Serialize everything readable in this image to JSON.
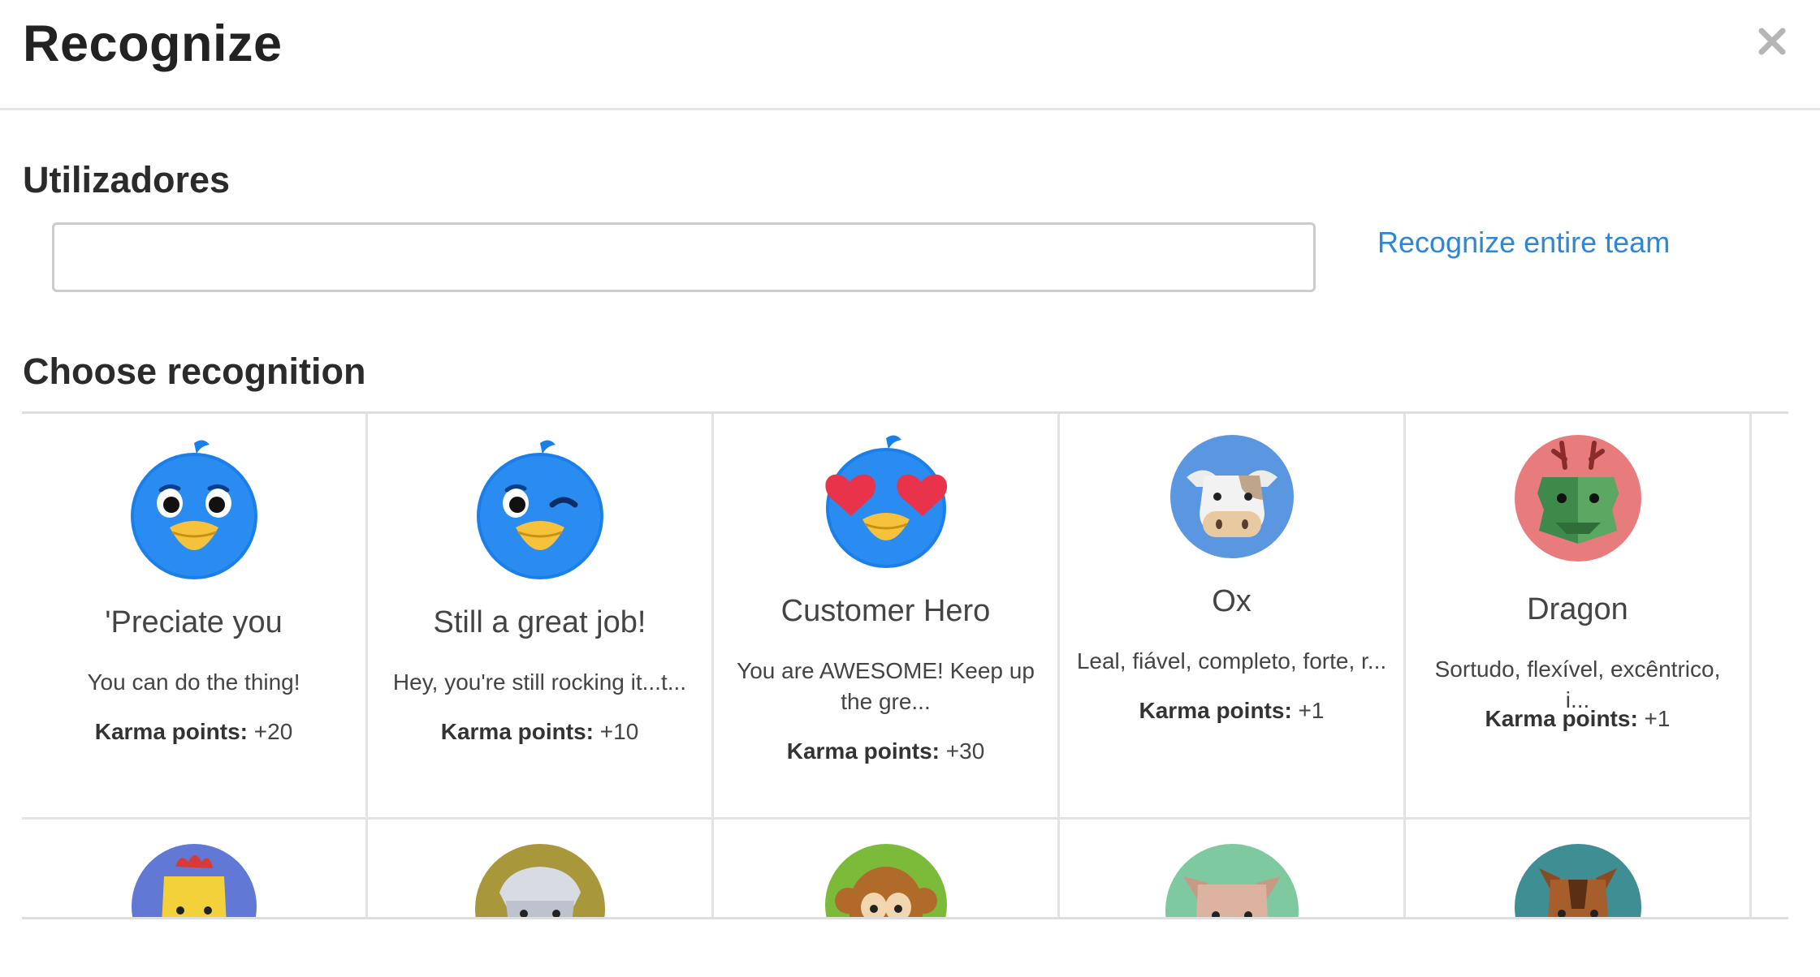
{
  "modal": {
    "title": "Recognize",
    "close_icon": "close-icon"
  },
  "users": {
    "label": "Utilizadores",
    "input_value": "",
    "input_placeholder": "",
    "team_link": "Recognize entire team"
  },
  "recognition": {
    "label": "Choose recognition",
    "karma_label": "Karma points:",
    "cards": [
      {
        "title": "'Preciate you",
        "description": "You can do the thing!",
        "karma": "+20",
        "icon": "bird-smile-icon"
      },
      {
        "title": "Still a great job!",
        "description": "Hey, you're still rocking it...t...",
        "karma": "+10",
        "icon": "bird-wink-icon"
      },
      {
        "title": "Customer Hero",
        "description": "You are AWESOME! Keep up the gre...",
        "karma": "+30",
        "icon": "bird-heart-eyes-icon"
      },
      {
        "title": "Ox",
        "description": "Leal, fiável, completo, forte, r...",
        "karma": "+1",
        "icon": "ox-icon"
      },
      {
        "title": "Dragon",
        "description": "Sortudo, flexível, excêntrico, i...",
        "karma": "+1",
        "icon": "dragon-icon"
      }
    ],
    "partial_row_icons": [
      "rooster-icon",
      "sheep-icon",
      "monkey-icon",
      "pig-icon",
      "horse-icon"
    ]
  },
  "colors": {
    "link": "#2d86d6",
    "bird_blue": "#1a7fe8",
    "beak_yellow": "#f6c23b",
    "ox_bg": "#5b97e0",
    "dragon_bg": "#e87b7b",
    "rooster_bg": "#6179d4",
    "sheep_bg": "#a9973b",
    "monkey_bg": "#7cbb3a",
    "pig_bg": "#7fc9a0",
    "horse_bg": "#3e8e93"
  }
}
